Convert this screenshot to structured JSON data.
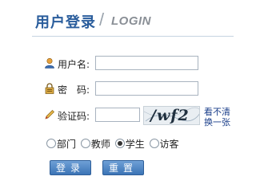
{
  "header": {
    "title_cn": "用户登录",
    "separator": "/",
    "title_en": "LOGIN"
  },
  "form": {
    "username_label": "用户名:",
    "username_value": "",
    "password_label": "密　码:",
    "password_value": "",
    "captcha_label": "验证码:",
    "captcha_value": "",
    "captcha_image_text": "/wf2",
    "refresh_line1": "看不清",
    "refresh_line2": "换一张"
  },
  "roles": {
    "items": [
      "部门",
      "教师",
      "学生",
      "访客"
    ],
    "selected": "学生"
  },
  "buttons": {
    "login": "登录",
    "reset": "重置"
  },
  "colors": {
    "brand": "#2a5d9c",
    "button": "#3b74b6",
    "link": "#1a3e8a"
  },
  "icons": {
    "username": "user-icon",
    "password": "lock-icon",
    "captcha": "pencil-icon"
  }
}
